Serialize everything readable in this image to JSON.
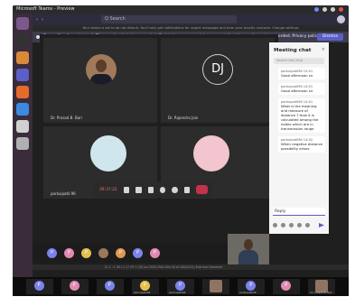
{
  "window": {
    "title": "Microsoft Teams - Preview"
  },
  "launcher": {
    "icons": [
      "ubuntu-dash-icon",
      "terminal-icon",
      "files-icon",
      "teams-icon",
      "firefox-icon",
      "chrome-icon",
      "settings-icon",
      "trash-icon"
    ]
  },
  "teams": {
    "search_placeholder": "Q Search",
    "notice": "Your status is set to do not disturb. You'll only get notifications for urgent messages and from your priority contacts. Change settings",
    "recording_banner": {
      "bold": "Recording has started.",
      "text": "The meeting is being recorded. By joining, you are giving consent for this meeting to be recorded. Privacy policy",
      "dismiss_label": "Dismiss"
    }
  },
  "participants": [
    {
      "name": "Dr. Prasad B. Bari",
      "kind": "photo"
    },
    {
      "name": "Dr. Rajendra Jain",
      "kind": "initials",
      "initials": "DJ"
    },
    {
      "name": "parkuipatil.96",
      "kind": "blob"
    },
    {
      "name": "",
      "kind": "blob"
    }
  ],
  "callbar": {
    "timer": "39:37:22",
    "icons": [
      "camera-icon",
      "mic-icon",
      "share-icon",
      "more-icon",
      "raise-hand-icon",
      "chat-icon",
      "participants-icon",
      "hangup-icon"
    ]
  },
  "chat": {
    "title": "Meeting chat",
    "search_placeholder": "Search this chat",
    "messages": [
      {
        "author": "parkuipatil96  14:01",
        "text": "Good afternoon sir"
      },
      {
        "author": "parkuipatil96  14:01",
        "text": "Good afternoon sir"
      },
      {
        "author": "parkuipatil96  14:01",
        "text": "What is the meaning and measure of distance ? How it is calculated among the nodes which are in transmission range"
      },
      {
        "author": "parkuipatil96  14:02",
        "text": "When negative distance possibility arises"
      }
    ],
    "input_value": "Reply"
  },
  "strip": {
    "bubbles": [
      "P",
      "P",
      "P",
      "P",
      "P",
      "P",
      "P"
    ]
  },
  "status_bar": {
    "text": "Cr 1 : 1 30 / 1 17          CR 1 (30 Jun 2021)  Edit     Dim 16 of 100(2021)   Edit and Comment"
  },
  "gallery": {
    "items": [
      {
        "initial": "P",
        "color": "blue",
        "label": ""
      },
      {
        "initial": "P",
        "color": "pink",
        "label": ""
      },
      {
        "initial": "P",
        "color": "blue",
        "label": ""
      },
      {
        "initial": "P",
        "color": "yellow",
        "label": "parkuipatil96"
      },
      {
        "initial": "P",
        "color": "blue",
        "label": "parkuipatil96"
      },
      {
        "initial": "",
        "color": "photo",
        "label": ""
      },
      {
        "initial": "P",
        "color": "blue",
        "label": "parkuipatil96"
      },
      {
        "initial": "P",
        "color": "pink",
        "label": ""
      },
      {
        "initial": "",
        "color": "photo",
        "label": "Dr. Prasad B. Bari"
      }
    ]
  }
}
